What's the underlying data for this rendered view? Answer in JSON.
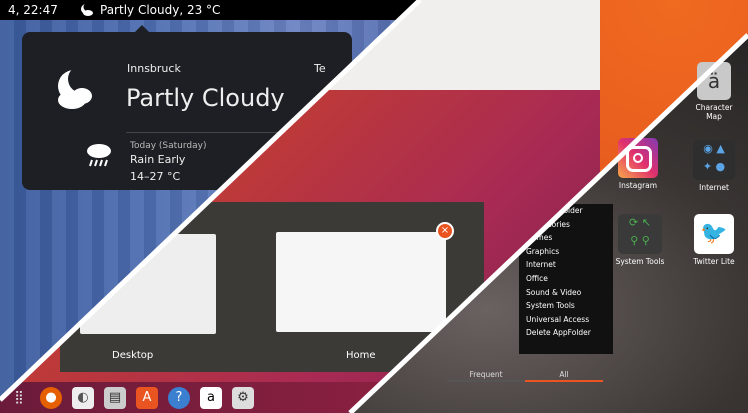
{
  "topbar": {
    "clock": "4, 22:47",
    "weather_summary": "Partly Cloudy, 23 °C"
  },
  "weather": {
    "city": "Innsbruck",
    "condition": "Partly Cloudy",
    "truncated": "Te",
    "forecast": {
      "day": "Today (Saturday)",
      "condition": "Rain Early",
      "temps": "14–27 °C"
    }
  },
  "overview": {
    "workspaces": [
      {
        "label": "Desktop"
      },
      {
        "label": "Home"
      }
    ]
  },
  "dock": {
    "icons": [
      "apps-grid-icon",
      "firefox-icon",
      "privacy-icon",
      "files-icon",
      "store-icon",
      "help-icon",
      "amazon-icon",
      "settings-icon"
    ]
  },
  "menu": {
    "items": [
      "New AppFolder",
      "Accessories",
      "Games",
      "Graphics",
      "Internet",
      "Office",
      "Sound & Video",
      "System Tools",
      "Universal Access",
      "Delete AppFolder"
    ],
    "tabs": {
      "frequent": "Frequent",
      "all": "All"
    }
  },
  "apps": {
    "character_map": "Character Map",
    "instagram": "Instagram",
    "internet": "Internet",
    "system_tools": "System Tools",
    "twitter": "Twitter Lite"
  }
}
